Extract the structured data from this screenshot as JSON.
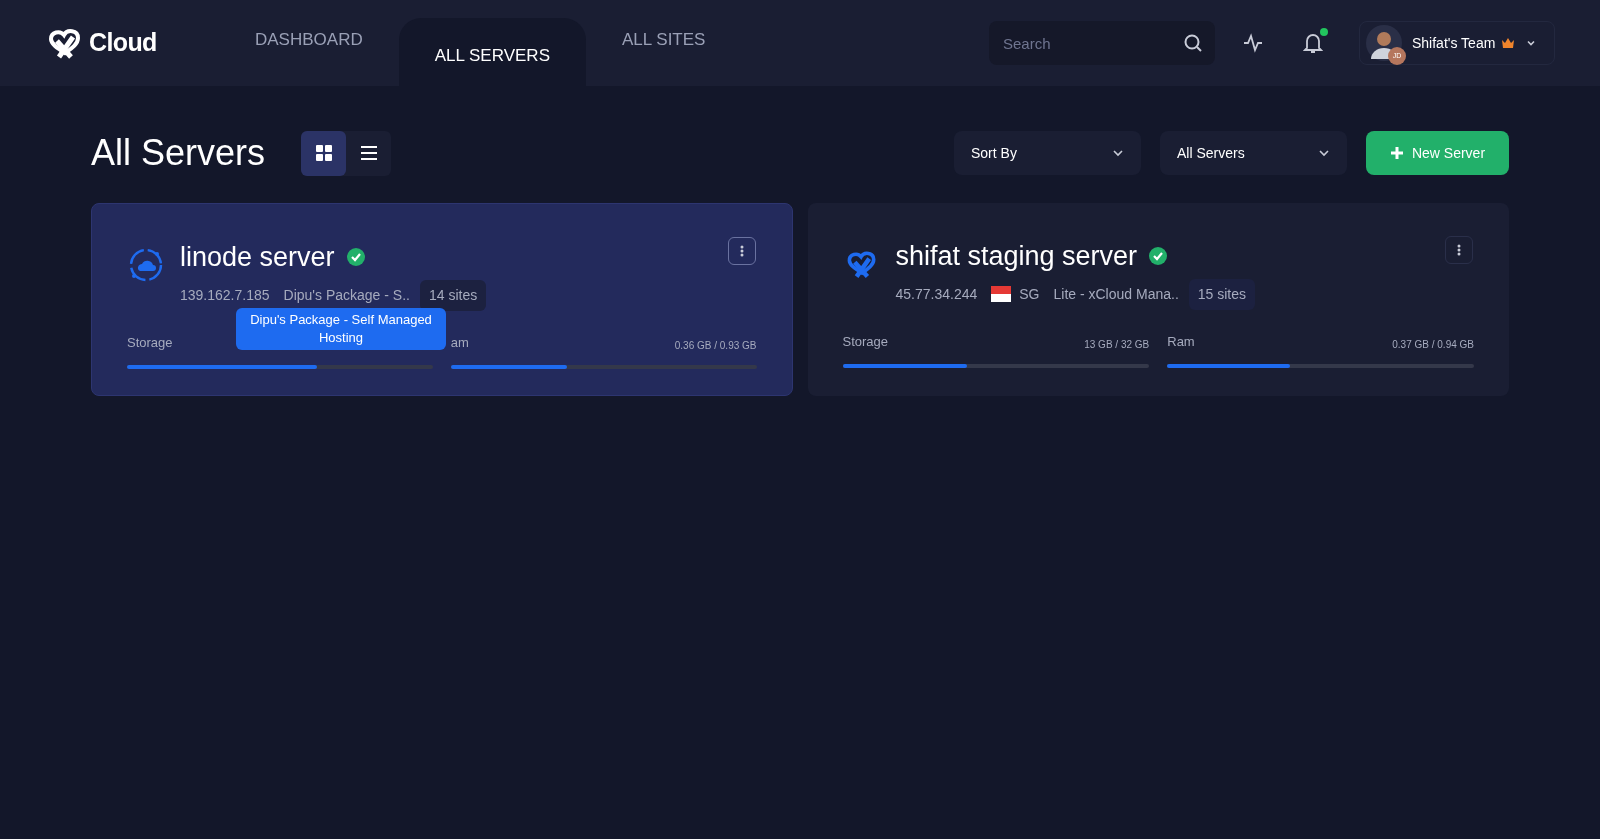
{
  "nav": {
    "logo": "Cloud",
    "tabs": [
      {
        "label": "DASHBOARD",
        "selected": false
      },
      {
        "label": "ALL SERVERS",
        "selected": true
      },
      {
        "label": "ALL SITES",
        "selected": false
      }
    ],
    "search": {
      "placeholder": "Search"
    },
    "notifications_unread": true,
    "team": "Shifat's Team",
    "avatar_badge": "JD"
  },
  "page": {
    "title": "All Servers",
    "views": [
      {
        "kind": "grid",
        "selected": true
      },
      {
        "kind": "list",
        "selected": false
      }
    ],
    "sort": "Sort By",
    "filter": "All Servers",
    "new_button": "New Server"
  },
  "servers": [
    {
      "kind": "cloud",
      "name": "linode server",
      "verified": true,
      "selected": true,
      "ip": "139.162.7.185",
      "plan": "Dipu's Package - S..",
      "sites": "14 sites",
      "tooltip": "Dipu's Package - Self Managed Hosting",
      "meters": [
        {
          "label": "Storage",
          "level": 0.62
        },
        {
          "label": "am",
          "reading": "0.36 GB / 0.93 GB",
          "level": 0.38
        }
      ]
    },
    {
      "kind": "xcloud",
      "name": "shifat staging server",
      "verified": true,
      "selected": false,
      "ip": "45.77.34.244",
      "region": "SG",
      "plan": "Lite - xCloud Mana..",
      "sites": "15 sites",
      "meters": [
        {
          "label": "Storage",
          "reading": "13 GB / 32 GB",
          "level": 0.405
        },
        {
          "label": "Ram",
          "reading": "0.37 GB / 0.94 GB",
          "level": 0.4
        }
      ]
    }
  ]
}
